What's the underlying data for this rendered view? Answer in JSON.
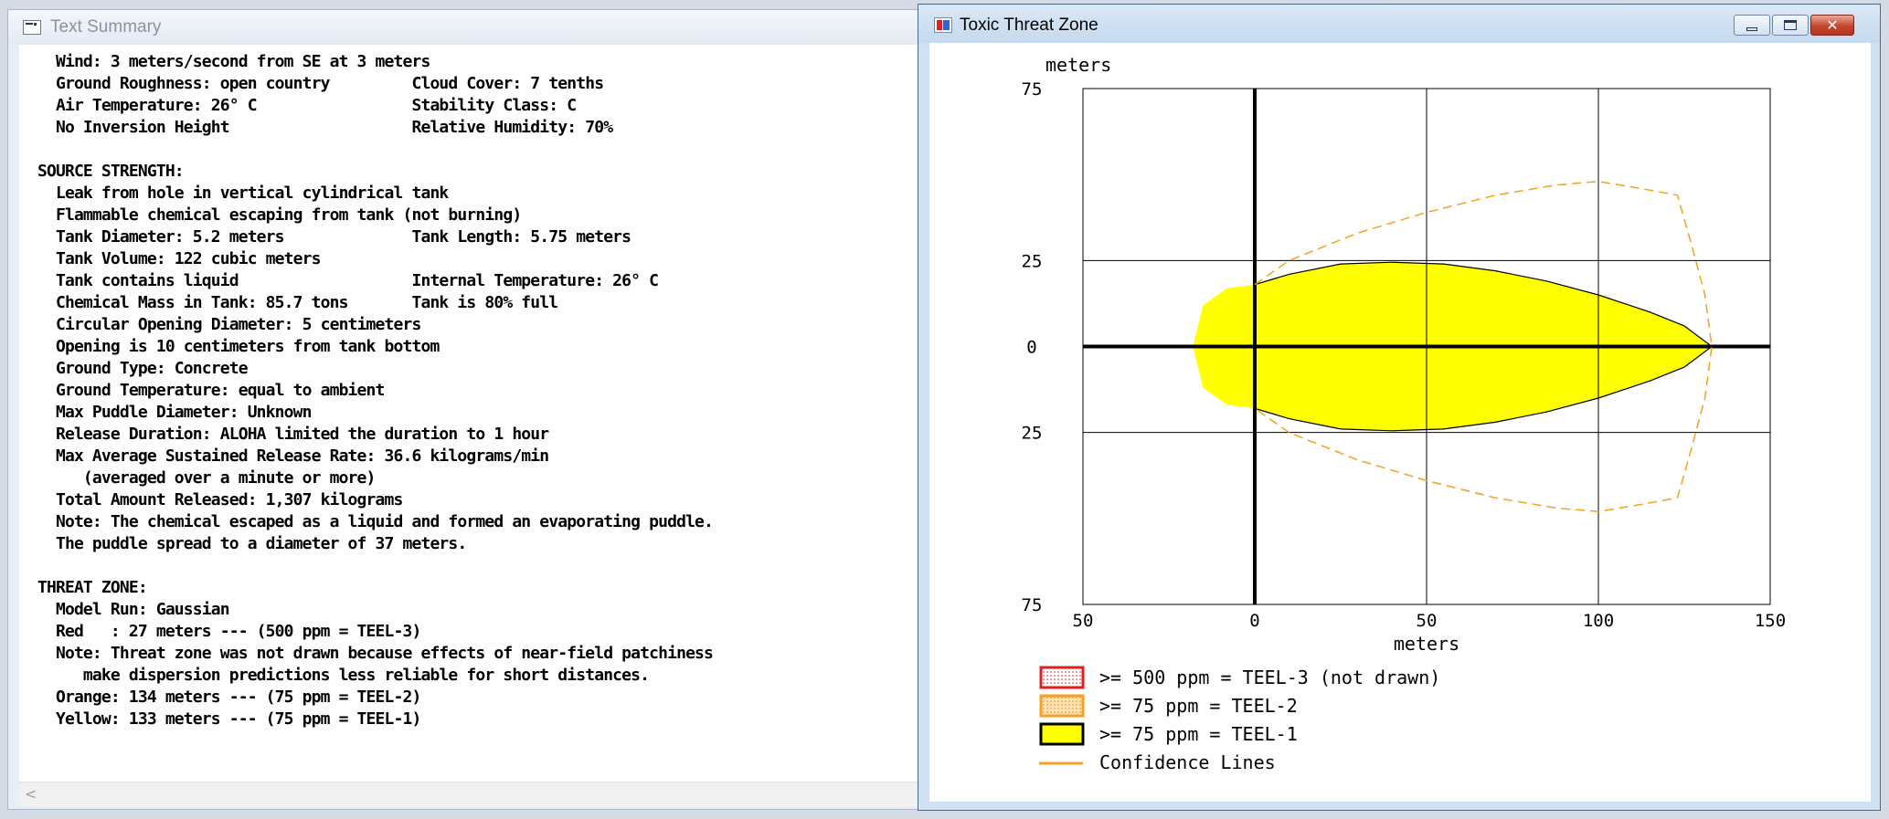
{
  "text_summary": {
    "title": "Text Summary",
    "lines": [
      "  Wind: 3 meters/second from SE at 3 meters",
      "  Ground Roughness: open country         Cloud Cover: 7 tenths",
      "  Air Temperature: 26° C                 Stability Class: C",
      "  No Inversion Height                    Relative Humidity: 70%",
      "",
      "SOURCE STRENGTH:",
      "  Leak from hole in vertical cylindrical tank",
      "  Flammable chemical escaping from tank (not burning)",
      "  Tank Diameter: 5.2 meters              Tank Length: 5.75 meters",
      "  Tank Volume: 122 cubic meters",
      "  Tank contains liquid                   Internal Temperature: 26° C",
      "  Chemical Mass in Tank: 85.7 tons       Tank is 80% full",
      "  Circular Opening Diameter: 5 centimeters",
      "  Opening is 10 centimeters from tank bottom",
      "  Ground Type: Concrete",
      "  Ground Temperature: equal to ambient",
      "  Max Puddle Diameter: Unknown",
      "  Release Duration: ALOHA limited the duration to 1 hour",
      "  Max Average Sustained Release Rate: 36.6 kilograms/min",
      "     (averaged over a minute or more)",
      "  Total Amount Released: 1,307 kilograms",
      "  Note: The chemical escaped as a liquid and formed an evaporating puddle.",
      "  The puddle spread to a diameter of 37 meters.",
      "",
      "THREAT ZONE:",
      "  Model Run: Gaussian",
      "  Red   : 27 meters --- (500 ppm = TEEL-3)",
      "  Note: Threat zone was not drawn because effects of near-field patchiness",
      "     make dispersion predictions less reliable for short distances.",
      "  Orange: 134 meters --- (75 ppm = TEEL-2)",
      "  Yellow: 133 meters --- (75 ppm = TEEL-1)"
    ]
  },
  "threat_zone": {
    "title": "Toxic Threat Zone",
    "y_unit_label": "meters",
    "x_axis_label": "meters",
    "colors": {
      "yellow": "#ffff00",
      "orange": "#f5a01e",
      "red": "#e02020",
      "confidence": "#f5a01e"
    },
    "legend": [
      {
        "label": ">= 500 ppm = TEEL-3 (not drawn)",
        "swatch": "red-dotted"
      },
      {
        "label": ">= 75 ppm = TEEL-2",
        "swatch": "orange-dotted"
      },
      {
        "label": ">= 75 ppm = TEEL-1",
        "swatch": "yellow-solid"
      },
      {
        "label": "Confidence Lines",
        "swatch": "line"
      }
    ]
  },
  "chart_data": {
    "type": "area",
    "xlabel": "meters",
    "ylabel": "meters",
    "x_ticks": [
      "50",
      "0",
      "50",
      "100",
      "150"
    ],
    "y_ticks": [
      "75",
      "25",
      "0",
      "25",
      "75"
    ],
    "xlim": [
      -50,
      150
    ],
    "ylim": [
      -75,
      75
    ],
    "grid": true,
    "series": [
      {
        "name": ">= 75 ppm = TEEL-1",
        "points": [
          [
            -18,
            0
          ],
          [
            -15,
            12
          ],
          [
            -8,
            17
          ],
          [
            0,
            18
          ],
          [
            10,
            21
          ],
          [
            25,
            24
          ],
          [
            40,
            24.5
          ],
          [
            55,
            24
          ],
          [
            70,
            22
          ],
          [
            85,
            19
          ],
          [
            100,
            15
          ],
          [
            115,
            10
          ],
          [
            125,
            6
          ],
          [
            133,
            0
          ],
          [
            125,
            -6
          ],
          [
            115,
            -10
          ],
          [
            100,
            -15
          ],
          [
            85,
            -19
          ],
          [
            70,
            -22
          ],
          [
            55,
            -24
          ],
          [
            40,
            -24.5
          ],
          [
            25,
            -24
          ],
          [
            10,
            -21
          ],
          [
            0,
            -18
          ],
          [
            -8,
            -17
          ],
          [
            -15,
            -12
          ]
        ]
      }
    ],
    "confidence_lines": [
      [
        0,
        18
      ],
      [
        10,
        25
      ],
      [
        30,
        33
      ],
      [
        50,
        39
      ],
      [
        70,
        44
      ],
      [
        88,
        47
      ],
      [
        100,
        48
      ],
      [
        112,
        46
      ],
      [
        123,
        44
      ],
      [
        127,
        30
      ],
      [
        131,
        15
      ],
      [
        133,
        0
      ],
      [
        131,
        -15
      ],
      [
        127,
        -30
      ],
      [
        123,
        -44
      ],
      [
        112,
        -46
      ],
      [
        100,
        -48
      ],
      [
        88,
        -47
      ],
      [
        70,
        -44
      ],
      [
        50,
        -39
      ],
      [
        30,
        -33
      ],
      [
        10,
        -25
      ],
      [
        0,
        -18
      ]
    ]
  }
}
